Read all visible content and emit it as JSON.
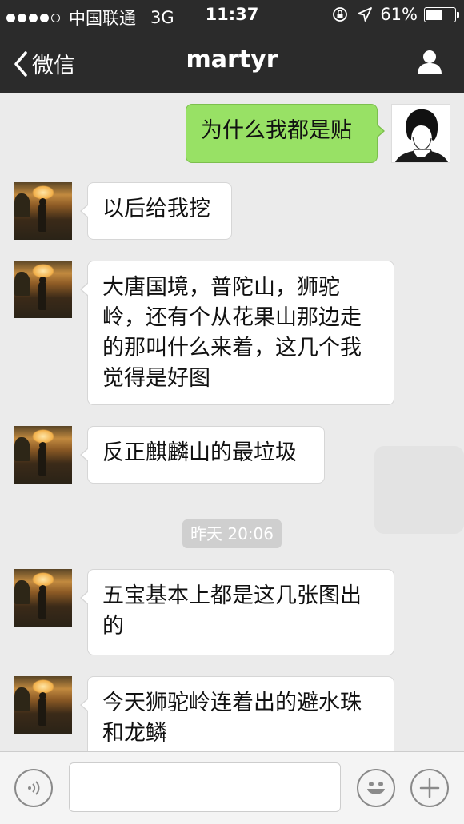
{
  "status_bar": {
    "carrier": "中国联通",
    "network": "3G",
    "time": "11:37",
    "battery": "61%",
    "battery_level": 0.61,
    "signal_bars": 4
  },
  "nav": {
    "back_label": "微信",
    "title": "martyr",
    "profile_icon": "person-icon"
  },
  "messages": [
    {
      "side": "right",
      "text": "为什么我都是贴"
    },
    {
      "side": "left",
      "text": "以后给我挖"
    },
    {
      "side": "left",
      "lines": [
        "大唐国境，普陀山，狮驼",
        "岭，还有个从花果山那边走",
        "的那叫什么来着，这几个我",
        "觉得是好图"
      ]
    },
    {
      "side": "left",
      "text": "反正麒麟山的最垃圾"
    },
    {
      "side": "left",
      "lines": [
        "五宝基本上都是这几张图出",
        "的"
      ]
    },
    {
      "side": "left",
      "lines": [
        "今天狮驼岭连着出的避水珠",
        "和龙鳞"
      ]
    }
  ],
  "timestamp": "昨天 20:06",
  "input_bar": {
    "voice_icon": "voice-icon",
    "emoji_icon": "emoji-icon",
    "add_icon": "plus-icon",
    "placeholder": ""
  },
  "colors": {
    "header": "#2b2b2b",
    "background": "#ebebeb",
    "sent_bubble": "#98e165",
    "received_bubble": "#ffffff"
  }
}
